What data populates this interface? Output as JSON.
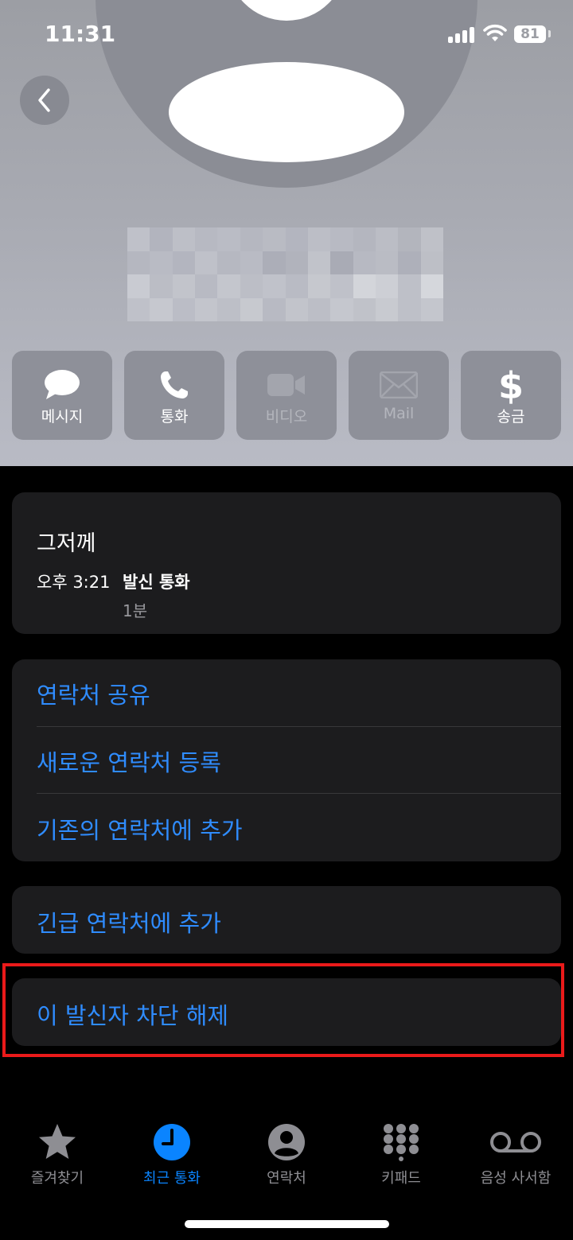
{
  "status_bar": {
    "time": "11:31",
    "battery": "81"
  },
  "actions": [
    {
      "label": "메시지",
      "icon": "message-bubble-icon",
      "enabled": true
    },
    {
      "label": "통화",
      "icon": "phone-icon",
      "enabled": true
    },
    {
      "label": "비디오",
      "icon": "video-icon",
      "enabled": false
    },
    {
      "label": "Mail",
      "icon": "mail-icon",
      "enabled": false
    },
    {
      "label": "송금",
      "icon": "dollar-icon",
      "enabled": true
    }
  ],
  "call_info": {
    "day": "그저께",
    "time": "오후 3:21",
    "type": "발신 통화",
    "duration": "1분"
  },
  "contact_options": [
    "연락처 공유",
    "새로운 연락처 등록",
    "기존의 연락처에 추가"
  ],
  "emergency": "긴급 연락처에 추가",
  "unblock": "이 발신자 차단 해제",
  "tabs": [
    {
      "label": "즐겨찾기",
      "icon": "star-icon",
      "active": false
    },
    {
      "label": "최근 통화",
      "icon": "clock-icon",
      "active": true
    },
    {
      "label": "연락처",
      "icon": "person-circle-icon",
      "active": false
    },
    {
      "label": "키패드",
      "icon": "keypad-icon",
      "active": false
    },
    {
      "label": "음성 사서함",
      "icon": "voicemail-icon",
      "active": false
    }
  ],
  "colors": {
    "link": "#2f8cff",
    "active_tab": "#0a84ff",
    "card": "#1c1c1e",
    "highlight": "#ea1a1a"
  }
}
